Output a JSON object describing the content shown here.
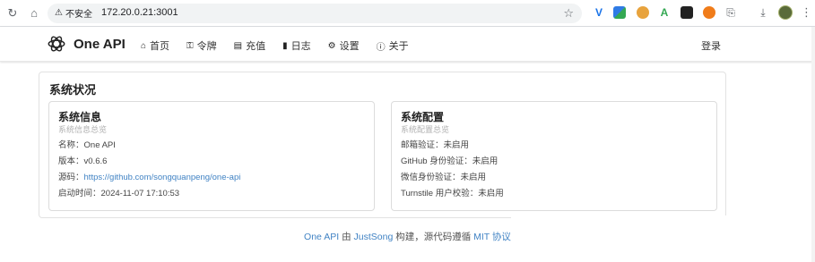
{
  "browser": {
    "security_label": "不安全",
    "url": "172.20.0.21:3001",
    "icons": [
      "reload-icon",
      "home-icon",
      "warning-icon",
      "star-icon",
      "extensions-icon",
      "download-icon",
      "profile-avatar",
      "menu-icon"
    ]
  },
  "header": {
    "brand_name": "One API",
    "nav": [
      {
        "label": "首页",
        "icon": "home-icon"
      },
      {
        "label": "令牌",
        "icon": "key-icon"
      },
      {
        "label": "充值",
        "icon": "cart-icon"
      },
      {
        "label": "日志",
        "icon": "book-icon"
      },
      {
        "label": "设置",
        "icon": "gear-icon"
      },
      {
        "label": "关于",
        "icon": "info-icon"
      }
    ],
    "login_label": "登录"
  },
  "status": {
    "title": "系统状况",
    "info": {
      "title": "系统信息",
      "subtitle": "系统信息总览",
      "name_label": "名称：",
      "name_value": "One API",
      "version_label": "版本：",
      "version_value": "v0.6.6",
      "source_label": "源码：",
      "source_value": "https://github.com/songquanpeng/one-api",
      "start_label": "启动时间：",
      "start_value": "2024-11-07 17:10:53"
    },
    "config": {
      "title": "系统配置",
      "subtitle": "系统配置总览",
      "lines": [
        "邮箱验证：未启用",
        "GitHub 身份验证：未启用",
        "微信身份验证：未启用",
        "Turnstile 用户校验：未启用"
      ]
    }
  },
  "footer": {
    "project": "One API",
    "by": " 由 ",
    "author": "JustSong",
    "built": " 构建，源代码遵循 ",
    "license": "MIT 协议"
  },
  "colors": {
    "link": "#4183c4",
    "border": "#dcdcdc"
  }
}
